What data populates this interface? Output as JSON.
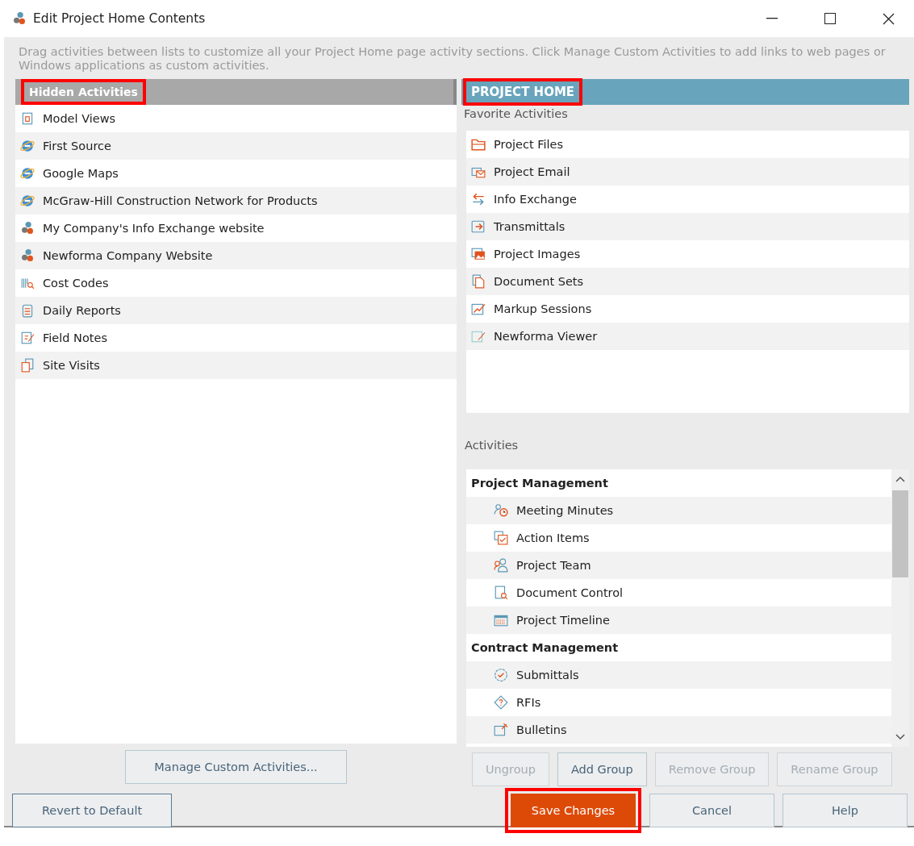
{
  "window": {
    "title": "Edit Project Home Contents"
  },
  "instructions": "Drag activities between lists to customize all your Project Home page activity sections.  Click Manage Custom Activities to add links to web pages or Windows applications as custom activities.",
  "hidden_panel": {
    "title": "Hidden Activities",
    "highlighted": true,
    "items": [
      {
        "label": "Model Views"
      },
      {
        "label": "First Source"
      },
      {
        "label": "Google Maps"
      },
      {
        "label": "McGraw-Hill Construction Network for Products"
      },
      {
        "label": "My Company's Info Exchange website"
      },
      {
        "label": "Newforma Company Website"
      },
      {
        "label": "Cost Codes"
      },
      {
        "label": "Daily Reports"
      },
      {
        "label": "Field Notes"
      },
      {
        "label": "Site Visits"
      }
    ]
  },
  "project_home": {
    "title": "PROJECT HOME",
    "highlighted": true,
    "favorites_label": "Favorite Activities",
    "favorites": [
      {
        "label": "Project Files"
      },
      {
        "label": "Project Email"
      },
      {
        "label": "Info Exchange"
      },
      {
        "label": "Transmittals"
      },
      {
        "label": "Project Images"
      },
      {
        "label": "Document Sets"
      },
      {
        "label": "Markup Sessions"
      },
      {
        "label": "Newforma Viewer"
      }
    ],
    "activities_label": "Activities",
    "activities": [
      {
        "kind": "group",
        "label": "Project Management"
      },
      {
        "kind": "item",
        "label": "Meeting Minutes"
      },
      {
        "kind": "item",
        "label": "Action Items"
      },
      {
        "kind": "item",
        "label": "Project Team"
      },
      {
        "kind": "item",
        "label": "Document Control"
      },
      {
        "kind": "item",
        "label": "Project Timeline"
      },
      {
        "kind": "group",
        "label": "Contract Management"
      },
      {
        "kind": "item",
        "label": "Submittals"
      },
      {
        "kind": "item",
        "label": "RFIs"
      },
      {
        "kind": "item",
        "label": "Bulletins"
      }
    ]
  },
  "manage_button": {
    "label": "Manage Custom Activities..."
  },
  "group_buttons": [
    {
      "label": "Ungroup",
      "disabled": true
    },
    {
      "label": "Add Group",
      "disabled": false
    },
    {
      "label": "Remove Group",
      "disabled": true
    },
    {
      "label": "Rename Group",
      "disabled": true
    }
  ],
  "revert_button": {
    "label": "Revert to Default"
  },
  "dialog_buttons": [
    {
      "label": "Save Changes",
      "primary": true,
      "highlighted": true
    },
    {
      "label": "Cancel",
      "primary": false,
      "highlighted": false
    },
    {
      "label": "Help",
      "primary": false,
      "highlighted": false
    }
  ]
}
